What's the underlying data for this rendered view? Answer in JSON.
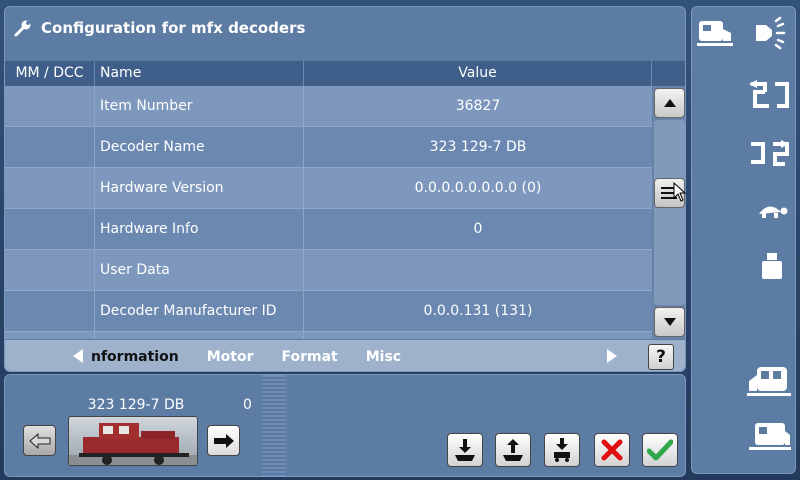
{
  "window": {
    "title": "Configuration for mfx decoders",
    "icon": "wrench-icon"
  },
  "table": {
    "headers": [
      "MM / DCC",
      "Name",
      "Value"
    ],
    "rows": [
      {
        "mm": "",
        "name": "Item Number",
        "value": "36827"
      },
      {
        "mm": "",
        "name": "Decoder Name",
        "value": "323 129-7 DB"
      },
      {
        "mm": "",
        "name": "Hardware Version",
        "value": "0.0.0.0.0.0.0.0 (0)"
      },
      {
        "mm": "",
        "name": "Hardware Info",
        "value": "0"
      },
      {
        "mm": "",
        "name": "User Data",
        "value": ""
      },
      {
        "mm": "",
        "name": "Decoder Manufacturer ID",
        "value": "0.0.0.131 (131)"
      },
      {
        "mm": "",
        "name": "",
        "value": ""
      }
    ]
  },
  "tabs": {
    "items": [
      "nformation",
      "Motor",
      "Format",
      "Misc"
    ],
    "active": "nformation",
    "help_label": "?"
  },
  "locomotive": {
    "name": "323 129-7 DB",
    "speed": "0"
  },
  "sidebar": {
    "icons": [
      "locomotive-icon",
      "light-icon",
      "swap-icon",
      "swap-alt-icon",
      "turtle-icon",
      "weight-icon",
      "locomotive-front-icon",
      "locomotive-side-icon"
    ]
  },
  "colors": {
    "panel": "#5d7ca4",
    "header": "#3f5f8a",
    "row_odd": "#7e98bd",
    "row_even": "#6b88b1",
    "tab_bar": "#9eb2cc",
    "cancel_red": "#e01010",
    "confirm_green": "#2ea84a"
  }
}
